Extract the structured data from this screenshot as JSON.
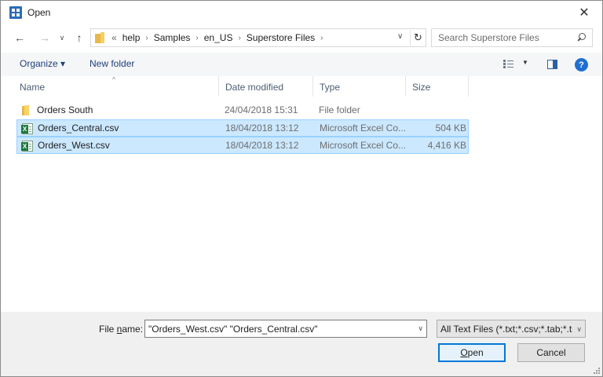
{
  "window": {
    "title": "Open",
    "close_symbol": "✕"
  },
  "navigation": {
    "back_symbol": "←",
    "forward_symbol": "→",
    "recent_symbol": "∨",
    "up_symbol": "↑",
    "breadcrumb_lead": "«",
    "breadcrumbs": [
      "help",
      "Samples",
      "en_US",
      "Superstore Files"
    ],
    "separator": "›",
    "dropdown_symbol": "∨",
    "refresh_symbol": "↻",
    "search_placeholder": "Search Superstore Files"
  },
  "toolbar": {
    "organize_label": "Organize ▾",
    "new_folder_label": "New folder",
    "view_dropdown_symbol": "▼",
    "help_symbol": "?"
  },
  "columns": {
    "name": "Name",
    "date_modified": "Date modified",
    "type": "Type",
    "size": "Size",
    "sort_indicator": "^"
  },
  "files": [
    {
      "name": "Orders South",
      "date": "24/04/2018 15:31",
      "type": "File folder",
      "size": "",
      "icon": "folder-icon",
      "selected": false
    },
    {
      "name": "Orders_Central.csv",
      "date": "18/04/2018 13:12",
      "type": "Microsoft Excel Co...",
      "size": "504 KB",
      "icon": "excel-csv-icon",
      "selected": true
    },
    {
      "name": "Orders_West.csv",
      "date": "18/04/2018 13:12",
      "type": "Microsoft Excel Co...",
      "size": "4,416 KB",
      "icon": "excel-csv-icon",
      "selected": true
    }
  ],
  "footer": {
    "file_name_label_prefix": "File ",
    "file_name_label_key": "n",
    "file_name_label_suffix": "ame:",
    "file_name_value": "\"Orders_West.csv\" \"Orders_Central.csv\"",
    "file_name_dropdown_symbol": "∨",
    "filter_value": "All Text Files (*.txt;*.csv;*.tab;*.tsv)",
    "filter_dropdown_symbol": "∨",
    "open_key": "O",
    "open_rest": "pen",
    "cancel_label": "Cancel"
  },
  "colors": {
    "selection_fill": "#cce8ff",
    "selection_border": "#99d1ff",
    "accent": "#0078d7",
    "folder": "#f7d46a",
    "excel": "#1d7a3f"
  }
}
